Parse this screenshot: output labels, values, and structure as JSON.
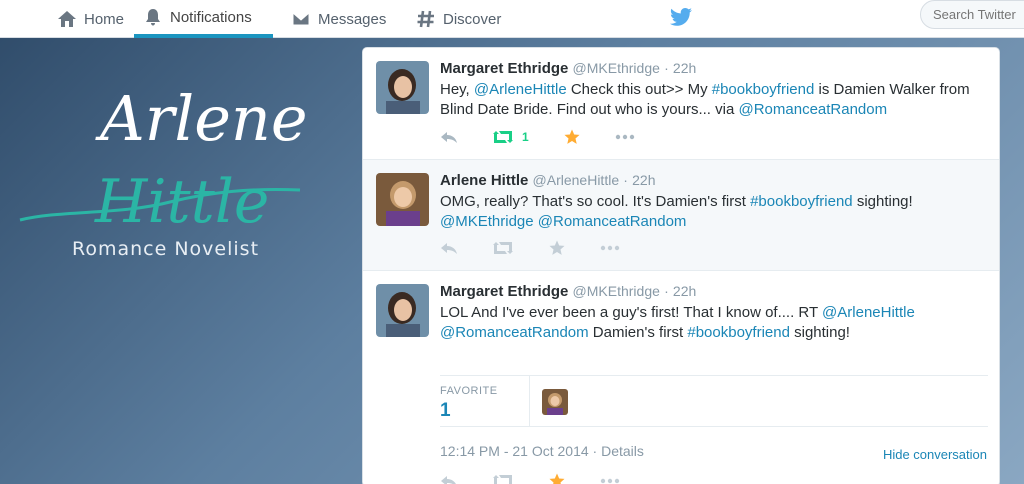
{
  "nav": {
    "home": "Home",
    "notifications": "Notifications",
    "messages": "Messages",
    "discover": "Discover"
  },
  "search": {
    "placeholder": "Search Twitter"
  },
  "brand": {
    "first_name": "Arlene",
    "last_name": "Hittle",
    "tagline": "Romance Novelist"
  },
  "tweets": [
    {
      "name": "Margaret Ethridge",
      "handle": "@MKEthridge",
      "time": "22h",
      "text": {
        "p1": "Hey, ",
        "m1": "@ArleneHittle",
        "p2": " Check this out>> My ",
        "h1": "#bookboyfriend",
        "p3": " is Damien Walker from Blind Date Bride. Find out who is yours... via ",
        "m2": "@RomanceatRandom"
      },
      "retweet_count": "1"
    },
    {
      "name": "Arlene Hittle",
      "handle": "@ArleneHittle",
      "time": "22h",
      "text": {
        "p1": "OMG, really? That's so cool. It's Damien's first ",
        "h1": "#bookboyfriend",
        "p2": " sighting! ",
        "m1": "@MKEthridge",
        "m2": "@RomanceatRandom"
      }
    },
    {
      "name": "Margaret Ethridge",
      "handle": "@MKEthridge",
      "time": "22h",
      "text": {
        "p1": "LOL And I've ever been a guy's first! That I know of.... RT ",
        "m1": "@ArleneHittle",
        "m2": "@RomanceatRandom",
        "p2": " Damien's first ",
        "h1": "#bookboyfriend",
        "p3": " sighting!"
      },
      "favorite_label": "FAVORITE",
      "favorite_count": "1",
      "timestamp": "12:14 PM - 21 Oct 2014",
      "details": "Details",
      "hide_conversation": "Hide conversation"
    }
  ],
  "colors": {
    "link": "#1b86b6",
    "retweet_active": "#19cf86",
    "favorite_active": "#ffac33",
    "action_inactive": "#aab8c2"
  }
}
